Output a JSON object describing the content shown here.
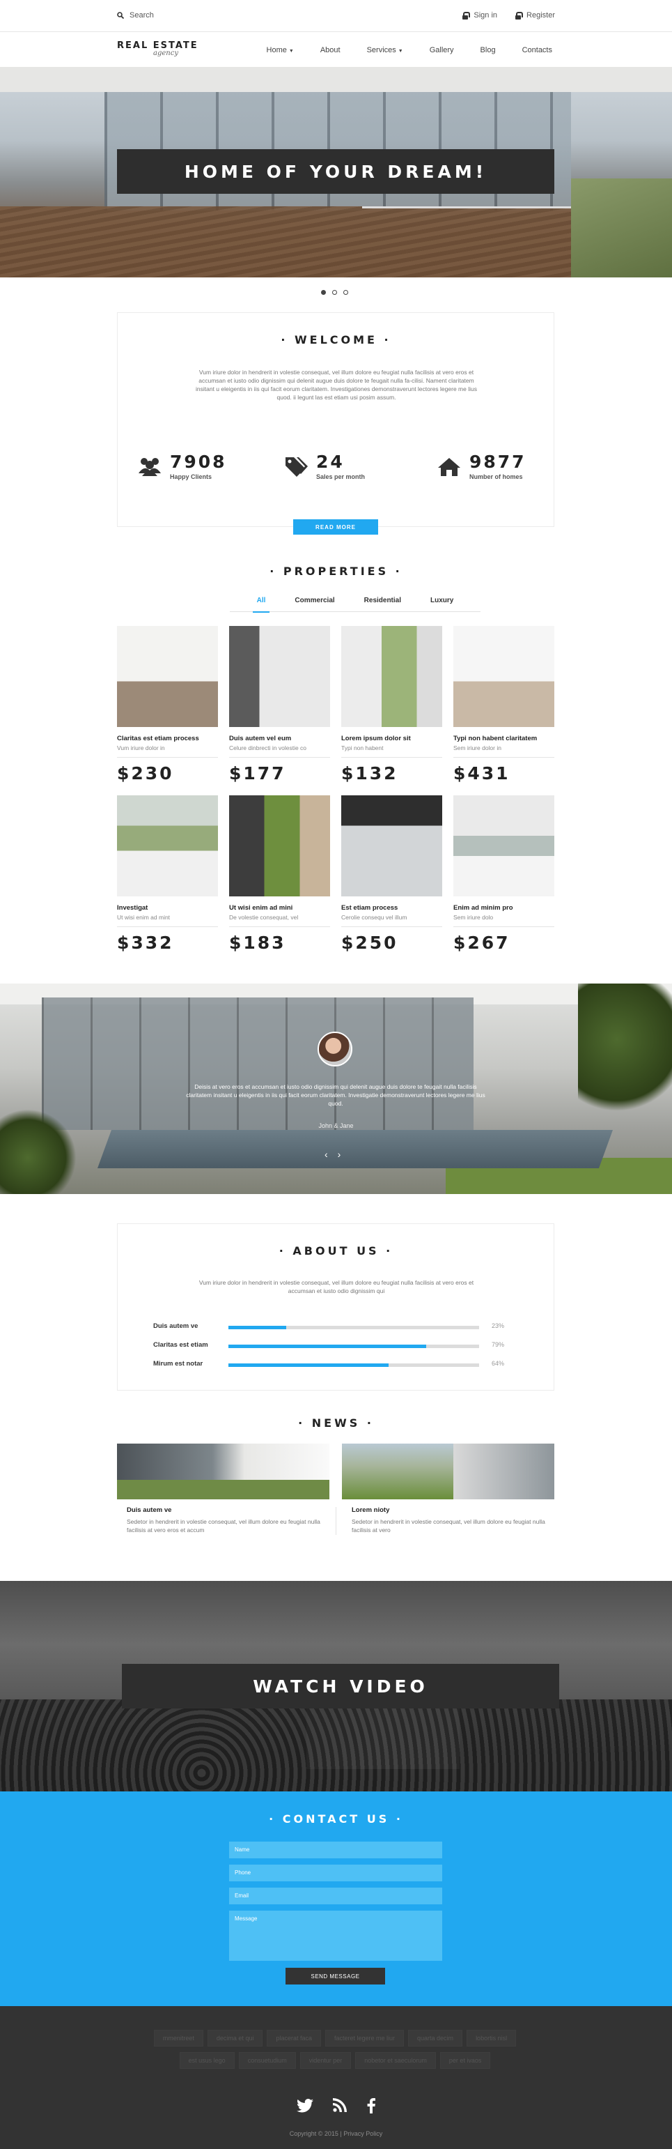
{
  "topbar": {
    "search_label": "Search",
    "signin_label": "Sign in",
    "register_label": "Register"
  },
  "logo": {
    "title": "REAL ESTATE",
    "subtitle": "agency"
  },
  "nav": {
    "items": [
      "Home",
      "About",
      "Services",
      "Gallery",
      "Blog",
      "Contacts"
    ]
  },
  "hero": {
    "title": "HOME OF YOUR DREAM!",
    "slides": 3,
    "active_slide": 1
  },
  "welcome": {
    "title": "WELCOME",
    "text": "Vum iriure dolor in hendrerit in volestie consequat, vel illum dolore eu feugiat nulla facilisis at vero eros et accumsan et iusto odio dignissim qui  delenit augue duis dolore te feugait nulla fa-cilisi. Nament claritatem insitant u eleigentis in iis qui facit eorum claritatem. Investigationes demonstraverunt lectores legere me lius quod. ii legunt las est etiam usi posim assum.",
    "stats": [
      {
        "value": "7908",
        "label": "Happy Clients",
        "icon": "users-icon"
      },
      {
        "value": "24",
        "label": "Sales per month",
        "icon": "tags-icon"
      },
      {
        "value": "9877",
        "label": "Number of homes",
        "icon": "home-icon"
      }
    ],
    "button": "READ MORE"
  },
  "properties": {
    "title": "PROPERTIES",
    "tabs": [
      "All",
      "Commercial",
      "Residential",
      "Luxury"
    ],
    "active_tab": "All",
    "items": [
      {
        "name": "Claritas est etiam process",
        "sub": "Vum iriure dolor in",
        "price": "$230"
      },
      {
        "name": "Duis autem vel eum",
        "sub": "Celure dinbrecti in volestie co",
        "price": "$177"
      },
      {
        "name": "Lorem ipsum dolor sit",
        "sub": "Typi non habent",
        "price": "$132"
      },
      {
        "name": "Typi non habent claritatem",
        "sub": "Sem iriure dolor in",
        "price": "$431"
      },
      {
        "name": "Investigat",
        "sub": "Ut wisi enim ad mint",
        "price": "$332"
      },
      {
        "name": "Ut wisi enim ad mini",
        "sub": "De volestie consequat, vel",
        "price": "$183"
      },
      {
        "name": "Est etiam process",
        "sub": "Cerolie consequ vel illum",
        "price": "$250"
      },
      {
        "name": "Enim ad minim pro",
        "sub": "Sem iriure dolo",
        "price": "$267"
      }
    ]
  },
  "testimonial": {
    "quote": "Deisis at vero eros et accumsan et iusto odio dignissim qui  delenit augue duis dolore te feugait nulla facilisis claritatem insitant u eleigentis in iis qui facit eorum claritatem. Investigatie demonstraverunt lectores legere me lius quod.",
    "author": "John & Jane"
  },
  "about": {
    "title": "ABOUT US",
    "text": "Vum iriure dolor in hendrerit in volestie consequat, vel illum dolore eu feugiat nulla facilisis at vero eros et accumsan et iusto odio dignissim qui",
    "skills": [
      {
        "label": "Duis autem ve",
        "percent": 23,
        "percent_text": "23%"
      },
      {
        "label": "Claritas est etiam",
        "percent": 79,
        "percent_text": "79%"
      },
      {
        "label": "Mirum est notar",
        "percent": 64,
        "percent_text": "64%"
      }
    ]
  },
  "news": {
    "title": "NEWS",
    "items": [
      {
        "title": "Duis autem ve",
        "text": "Sedetor in hendrerit in volestie consequat, vel illum dolore eu feugiat nulla facilisis at vero eros et accum"
      },
      {
        "title": "Lorem nioty",
        "text": "Sedetor in hendrerit in volestie consequat, vel illum dolore eu feugiat nulla facilisis at vero"
      }
    ]
  },
  "video": {
    "title": "WATCH VIDEO"
  },
  "contact": {
    "title": "CONTACT US",
    "fields": {
      "name": "Name",
      "phone": "Phone",
      "email": "Email",
      "message": "Message"
    },
    "button": "SEND MESSAGE"
  },
  "footer": {
    "tags_row1": [
      "mmenitreet",
      "decima et qui",
      "placerat faca",
      "facteret legere me liur",
      "quarta decim",
      "lobortis nisl"
    ],
    "tags_row2": [
      "est usus lego",
      "consuetudium",
      "videntur per",
      "nobetor et saeculorum",
      "per et ivaos"
    ],
    "social": [
      "twitter-icon",
      "rss-icon",
      "facebook-icon"
    ],
    "copyright": "Copyright © 2015 | Privacy Policy"
  },
  "colors": {
    "accent": "#21a8f0",
    "dark": "#2e2e2e",
    "footer": "#333333"
  }
}
